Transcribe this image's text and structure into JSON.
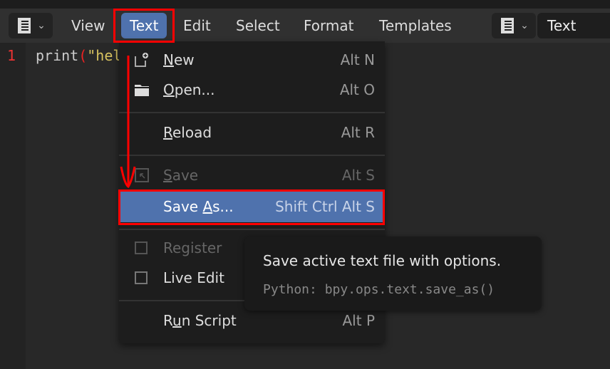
{
  "header": {
    "menus": [
      "View",
      "Text",
      "Edit",
      "Select",
      "Format",
      "Templates"
    ],
    "active_menu": "Text",
    "text_field": "Text"
  },
  "editor": {
    "line_number": "1",
    "code": {
      "pre": "print",
      "open": "(",
      "str": "\"hello blender\"",
      "close": ")"
    }
  },
  "menu": {
    "items": [
      {
        "label": "New",
        "underline": "N",
        "rest": "ew",
        "shortcut": "Alt N",
        "icon": "new-file-icon"
      },
      {
        "label": "Open...",
        "underline": "O",
        "rest": "pen...",
        "shortcut": "Alt O",
        "icon": "folder-icon"
      },
      {
        "label": "Reload",
        "underline": "R",
        "rest": "eload",
        "shortcut": "Alt R"
      },
      {
        "label": "Save",
        "underline": "S",
        "rest": "ave",
        "shortcut": "Alt S",
        "icon": "save-icon",
        "disabled": true
      },
      {
        "label": "Save As...",
        "pre": "Save ",
        "underline": "A",
        "rest": "s...",
        "shortcut": "Shift Ctrl Alt S",
        "highlighted": true
      },
      {
        "label": "Register",
        "disabled": true,
        "checkbox": false
      },
      {
        "label": "Live Edit",
        "checkbox": false
      },
      {
        "label": "Run Script",
        "pre": "R",
        "underline": "u",
        "rest": "n Script",
        "shortcut": "Alt P"
      }
    ]
  },
  "tooltip": {
    "title": "Save active text file with options.",
    "python": "Python: bpy.ops.text.save_as()"
  },
  "colors": {
    "accent": "#4f72ad",
    "annotation": "#ff0000"
  }
}
